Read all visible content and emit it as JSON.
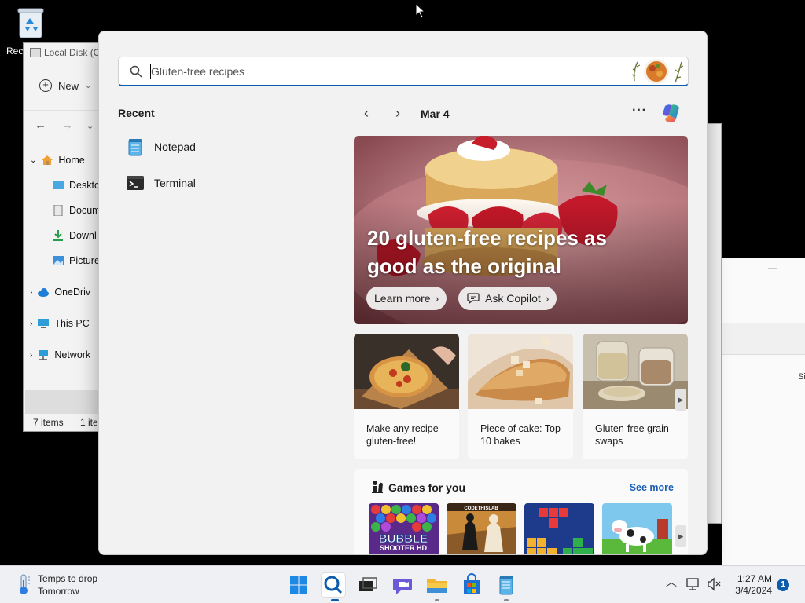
{
  "desktop": {
    "recycle_label": "Rec"
  },
  "explorer": {
    "title": "Local Disk (C",
    "new_label": "New",
    "tree": [
      {
        "label": "Home"
      },
      {
        "label": "Deskto"
      },
      {
        "label": "Docum"
      },
      {
        "label": "Downl"
      },
      {
        "label": "Picture"
      },
      {
        "label": "OneDriv"
      },
      {
        "label": "This PC"
      },
      {
        "label": "Network"
      }
    ],
    "status_items": "7 items",
    "status_selected": "1 ite"
  },
  "right_window": {
    "partial_text": "Si",
    "min_label": "—"
  },
  "search": {
    "placeholder": "Gluten-free recipes"
  },
  "recent": {
    "title": "Recent",
    "items": [
      {
        "label": "Notepad",
        "icon": "notepad-icon"
      },
      {
        "label": "Terminal",
        "icon": "terminal-icon"
      }
    ]
  },
  "feed": {
    "date": "Mar 4",
    "more_label": "···",
    "hero": {
      "headline": "20 gluten-free recipes as good as the original",
      "learn_more": "Learn more",
      "ask_copilot": "Ask Copilot"
    },
    "cards": [
      {
        "caption": "Make any recipe gluten-free!"
      },
      {
        "caption": "Piece of cake: Top 10 bakes"
      },
      {
        "caption": "Gluten-free grain swaps"
      }
    ],
    "games": {
      "title": "Games for you",
      "see_more": "See more",
      "tiles": [
        {
          "name": "Bubble Shooter",
          "label_line1": "BUBBLE",
          "label_line2": "SHOOTER HD"
        },
        {
          "name": "Chess",
          "label_line1": "CODETHISLAB"
        },
        {
          "name": "Block puzzle"
        },
        {
          "name": "Farm"
        }
      ]
    }
  },
  "taskbar": {
    "weather_line1": "Temps to drop",
    "weather_line2": "Tomorrow",
    "time": "1:27 AM",
    "date": "3/4/2024",
    "notifications": "1"
  },
  "colors": {
    "accent": "#0b5cad",
    "see_more": "#1a5fb4"
  }
}
